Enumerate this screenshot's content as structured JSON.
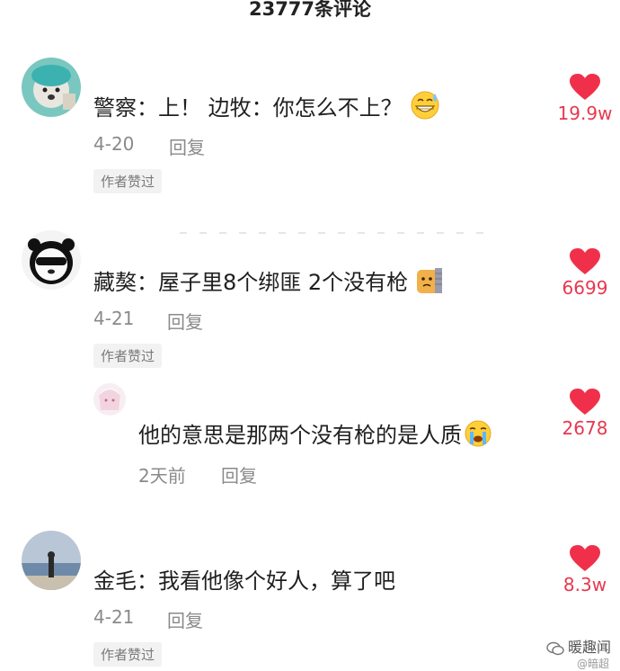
{
  "header": {
    "count_label": "23777条评论"
  },
  "comments": [
    {
      "text": "警察：上！   边牧：你怎么不上？",
      "emoji": "sweat-smile-emoji",
      "date": "4-20",
      "reply_label": "回复",
      "badge": "作者赞过",
      "likes": "19.9w"
    },
    {
      "text": "藏獒：屋子里8个绑匪 2个没有枪",
      "emoji": "dog-face-emoji",
      "date": "4-21",
      "reply_label": "回复",
      "badge": "作者赞过",
      "likes": "6699"
    },
    {
      "text": "他的意思是那两个没有枪的是人质",
      "emoji": "crying-face-emoji",
      "date": "2天前",
      "reply_label": "回复",
      "likes": "2678"
    },
    {
      "text": "金毛：我看他像个好人，算了吧",
      "date": "4-21",
      "reply_label": "回复",
      "badge": "作者赞过",
      "likes": "8.3w"
    }
  ],
  "watermark": {
    "label": "暖趣闻",
    "sub": "@暗超"
  },
  "colors": {
    "heart": "#f0304a",
    "like_text": "#e8384f",
    "meta": "#8a8a8a",
    "badge_bg": "#f2f2f2"
  }
}
